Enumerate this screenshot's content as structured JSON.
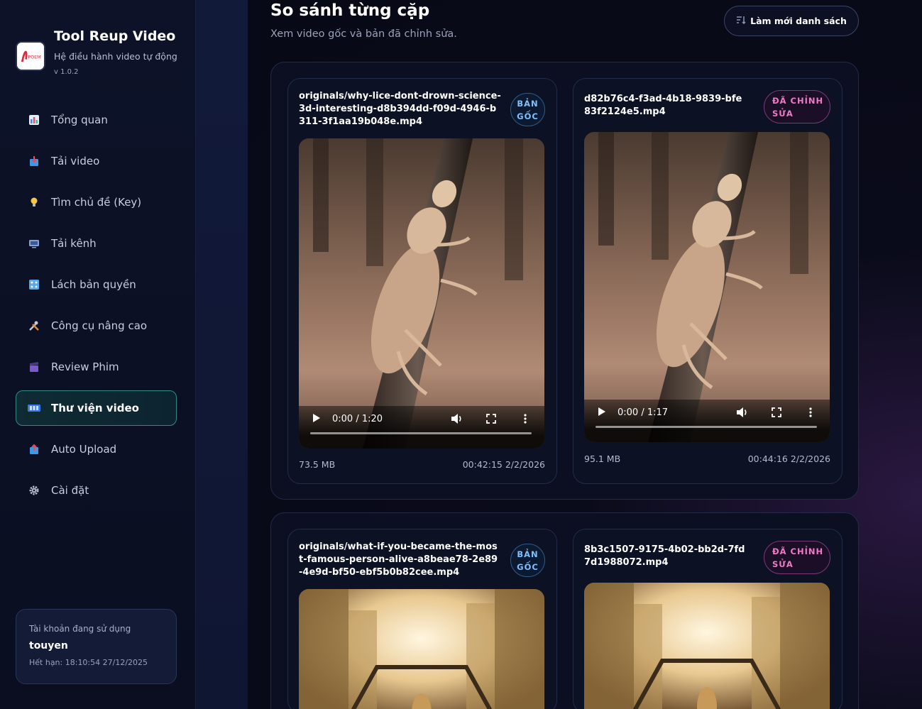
{
  "sidebar": {
    "brand": {
      "title": "Tool Reup Video",
      "subtitle": "Hệ điều hành video tự động",
      "version": "v 1.0.2",
      "logo_text": "POEM"
    },
    "items": [
      {
        "label": "Tổng quan",
        "icon": "bar-chart-icon",
        "active": false
      },
      {
        "label": "Tải video",
        "icon": "download-box-icon",
        "active": false
      },
      {
        "label": "Tìm chủ đề (Key)",
        "icon": "lightbulb-icon",
        "active": false
      },
      {
        "label": "Tải kênh",
        "icon": "tv-icon",
        "active": false
      },
      {
        "label": "Lách bản quyền",
        "icon": "grid-icon",
        "active": false
      },
      {
        "label": "Công cụ nâng cao",
        "icon": "tools-icon",
        "active": false
      },
      {
        "label": "Review Phim",
        "icon": "clapper-icon",
        "active": false
      },
      {
        "label": "Thư viện video",
        "icon": "film-strip-icon",
        "active": true
      },
      {
        "label": "Auto Upload",
        "icon": "upload-box-icon",
        "active": false
      },
      {
        "label": "Cài đặt",
        "icon": "gear-icon",
        "active": false
      }
    ],
    "account": {
      "label": "Tài khoản đang sử dụng",
      "username": "touyen",
      "expiry": "Hết hạn: 18:10:54 27/12/2025"
    }
  },
  "main": {
    "title": "So sánh từng cặp",
    "subtitle": "Xem video gốc và bản đã chỉnh sửa.",
    "refresh_label": "Làm mới danh sách",
    "pairs": [
      {
        "original": {
          "filename": "originals/why-lice-dont-drown-science-3d-interesting-d8b394dd-f09d-4946-b311-3f1aa19b048e.mp4",
          "badge": [
            "BẢN",
            "GỐC"
          ],
          "time": "0:00 / 1:20",
          "size": "73.5 MB",
          "date": "00:42:15 2/2/2026",
          "progress": 0
        },
        "edited": {
          "filename": "d82b76c4-f3ad-4b18-9839-bfe83f2124e5.mp4",
          "badge": [
            "ĐÃ CHỈNH",
            "SỬA"
          ],
          "time": "0:00 / 1:17",
          "size": "95.1 MB",
          "date": "00:44:16 2/2/2026",
          "progress": 0
        }
      },
      {
        "original": {
          "filename": "originals/what-if-you-became-the-most-famous-person-alive-a8beae78-2e89-4e9d-bf50-ebf5b0b82cee.mp4",
          "badge": [
            "BẢN",
            "GỐC"
          ]
        },
        "edited": {
          "filename": "8b3c1507-9175-4b02-bb2d-7fd7d1988072.mp4",
          "badge": [
            "ĐÃ CHỈNH",
            "SỬA"
          ]
        }
      }
    ]
  },
  "colors": {
    "accent_teal": "#2f8a86",
    "badge_original": "#7fc0ff",
    "badge_edited": "#f07ac8",
    "background": "#0a0b1a"
  }
}
